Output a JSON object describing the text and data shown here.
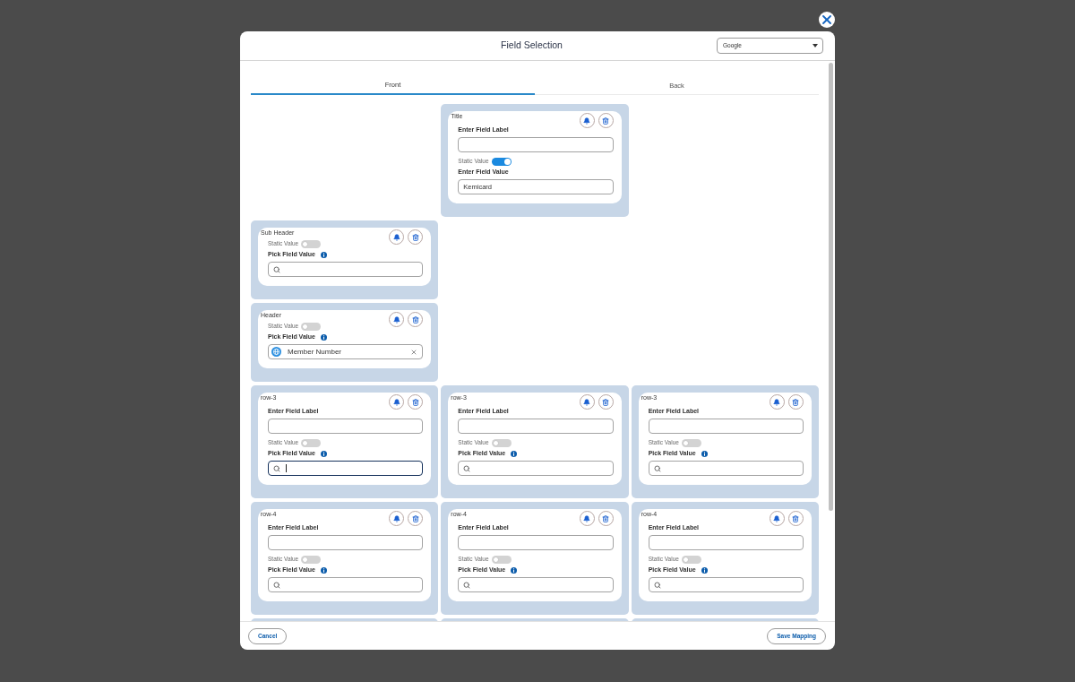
{
  "dialog": {
    "title": "Field Selection",
    "source_select": {
      "value": "Google"
    },
    "tabs": [
      {
        "label": "Front",
        "selected": true
      },
      {
        "label": "Back",
        "selected": false
      }
    ],
    "grid_rows": [
      {
        "cells": [
          {
            "kind": "empty"
          },
          {
            "kind": "card",
            "label": "Title",
            "label_input": {
              "heading": "Enter Field Label"
            },
            "static_value": {
              "label": "Static Value",
              "on": true
            },
            "value_field": {
              "kind": "text",
              "heading": "Enter Field Value",
              "value": "Kemicard",
              "focused": false
            }
          },
          {
            "kind": "empty"
          }
        ]
      },
      {
        "cells": [
          {
            "kind": "card",
            "label": "Sub Header",
            "static_value": {
              "label": "Static Value",
              "on": false
            },
            "value_field": {
              "kind": "search",
              "heading": "Pick Field Value",
              "focused": false
            }
          },
          {
            "kind": "empty"
          },
          {
            "kind": "empty"
          }
        ]
      },
      {
        "cells": [
          {
            "kind": "card",
            "label": "Header",
            "static_value": {
              "label": "Static Value",
              "on": false
            },
            "value_field": {
              "kind": "chip",
              "heading": "Pick Field Value",
              "value": "Member Number",
              "focused": false
            }
          },
          {
            "kind": "empty"
          },
          {
            "kind": "empty"
          }
        ]
      },
      {
        "cells": [
          {
            "kind": "card",
            "label": "row-3",
            "label_input": {
              "heading": "Enter Field Label"
            },
            "static_value": {
              "label": "Static Value",
              "on": false
            },
            "value_field": {
              "kind": "search",
              "heading": "Pick Field Value",
              "focused": true
            }
          },
          {
            "kind": "card",
            "label": "row-3",
            "label_input": {
              "heading": "Enter Field Label"
            },
            "static_value": {
              "label": "Static Value",
              "on": false
            },
            "value_field": {
              "kind": "search",
              "heading": "Pick Field Value",
              "focused": false
            }
          },
          {
            "kind": "card",
            "label": "row-3",
            "label_input": {
              "heading": "Enter Field Label"
            },
            "static_value": {
              "label": "Static Value",
              "on": false
            },
            "value_field": {
              "kind": "search",
              "heading": "Pick Field Value",
              "focused": false
            }
          }
        ]
      },
      {
        "cells": [
          {
            "kind": "card",
            "label": "row-4",
            "label_input": {
              "heading": "Enter Field Label"
            },
            "static_value": {
              "label": "Static Value",
              "on": false
            },
            "value_field": {
              "kind": "search",
              "heading": "Pick Field Value",
              "focused": false
            }
          },
          {
            "kind": "card",
            "label": "row-4",
            "label_input": {
              "heading": "Enter Field Label"
            },
            "static_value": {
              "label": "Static Value",
              "on": false
            },
            "value_field": {
              "kind": "search",
              "heading": "Pick Field Value",
              "focused": false
            }
          },
          {
            "kind": "card",
            "label": "row-4",
            "label_input": {
              "heading": "Enter Field Label"
            },
            "static_value": {
              "label": "Static Value",
              "on": false
            },
            "value_field": {
              "kind": "search",
              "heading": "Pick Field Value",
              "focused": false
            }
          }
        ]
      },
      {
        "cells": [
          {
            "kind": "clipped"
          },
          {
            "kind": "clipped"
          },
          {
            "kind": "clipped"
          }
        ]
      }
    ]
  },
  "footer": {
    "buttons": [
      {
        "label": "Cancel"
      },
      {
        "label": "Save Mapping"
      }
    ]
  }
}
